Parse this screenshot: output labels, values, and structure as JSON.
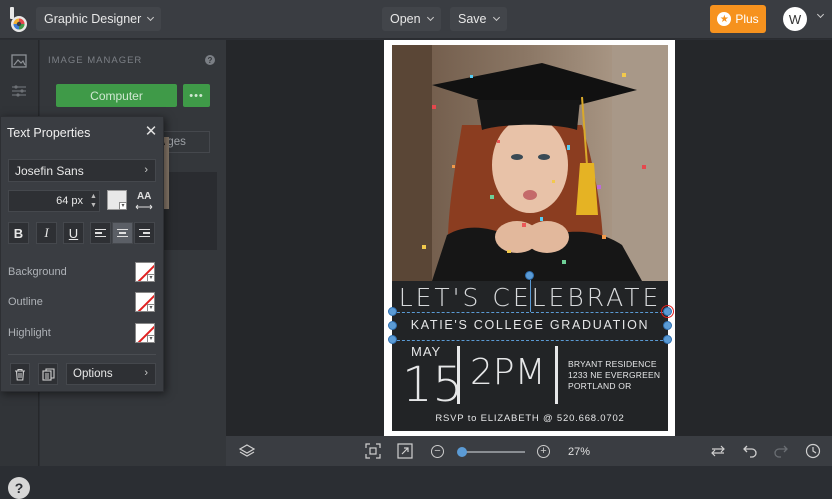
{
  "header": {
    "app_name": "Graphic Designer",
    "open_label": "Open",
    "save_label": "Save",
    "plus_label": "Plus",
    "user_initial": "W"
  },
  "image_manager": {
    "title": "IMAGE MANAGER",
    "computer_label": "Computer",
    "more_label": "•••",
    "tab_label": "ages"
  },
  "text_properties": {
    "title": "Text Properties",
    "font": "Josefin Sans",
    "size": "64 px",
    "text_color": "#e8e8e8",
    "bold": "B",
    "italic": "I",
    "underline": "U",
    "case_label": "AA",
    "background_label": "Background",
    "outline_label": "Outline",
    "highlight_label": "Highlight",
    "options_label": "Options"
  },
  "design": {
    "headline": "LET'S CELEBRATE",
    "subtitle": "KATIE'S COLLEGE GRADUATION",
    "month": "MAY",
    "day": "15",
    "time": "2PM",
    "address": [
      "BRYANT RESIDENCE",
      "1233 NE EVERGREEN",
      "PORTLAND OR"
    ],
    "rsvp": "RSVP to ELIZABETH @ 520.668.0702"
  },
  "bottom": {
    "zoom": "27%",
    "zoom_level": 0.05
  },
  "colors": {
    "accent_green": "#3f9a48",
    "plus_orange": "#f6921e",
    "selection_blue": "#5b9bd5"
  }
}
